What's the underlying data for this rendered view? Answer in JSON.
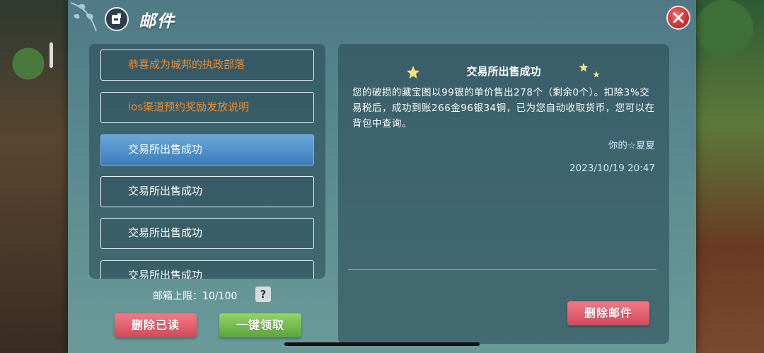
{
  "window": {
    "title": "邮件"
  },
  "mail_list": {
    "items": [
      {
        "subject": "恭喜成为城邦的执政部落",
        "unread": true,
        "selected": false
      },
      {
        "subject": "ios渠道预约奖励发放说明",
        "unread": true,
        "selected": false
      },
      {
        "subject": "交易所出售成功",
        "unread": false,
        "selected": true
      },
      {
        "subject": "交易所出售成功",
        "unread": false,
        "selected": false
      },
      {
        "subject": "交易所出售成功",
        "unread": false,
        "selected": false
      },
      {
        "subject": "交易所出售成功",
        "unread": false,
        "selected": false
      }
    ]
  },
  "mailbox": {
    "quota_label": "邮箱上限：",
    "quota_value": "10/100",
    "help_label": "?"
  },
  "actions": {
    "delete_read": "删除已读",
    "claim_all": "一键领取",
    "delete_mail": "删除邮件"
  },
  "detail": {
    "title": "交易所出售成功",
    "body": "您的破损的藏宝图以99银的单价售出278个（剩余0个）。扣除3%交易税后，成功到账266金96银34铜，已为您自动收取货币，您可以在背包中查询。",
    "sender": "你的☆夏夏",
    "time": "2023/10/19 20:47"
  },
  "colors": {
    "unread_text": "#f28a2e",
    "selected_item": "#3c7dbb",
    "close_button": "#c42a2a",
    "delete_button": "#d24a5a",
    "claim_button": "#5aa63a"
  }
}
